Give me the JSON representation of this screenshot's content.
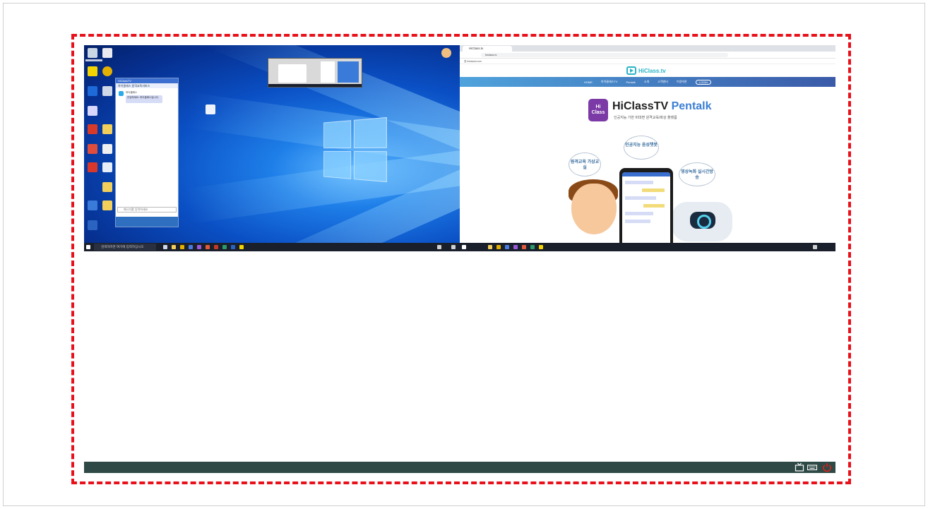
{
  "left_desktop": {
    "chat_window_title": "HiClassTV",
    "chat_subtitle": "하이클래스 원격교육서비스",
    "chat_sender": "하이클래스",
    "chat_message": "안녕하세요. 하이클래스입니다.",
    "chat_input_placeholder": "메시지를 입력하세요",
    "taskbar_search": "검색하려면 여기에 입력하십시오"
  },
  "browser": {
    "tab_title": "HiClass.tv",
    "url": "hiclass.tv",
    "bookmark_text": "앱  hiclasstv.com",
    "site_logo": "HiClass.tv",
    "nav_items": [
      "HOME",
      "하이클래스TV",
      "Pentalk",
      "소개",
      "고객센터",
      "이용약관"
    ],
    "nav_pill": "LOGIN",
    "brand_logo_line1": "Hi",
    "brand_logo_line2": "Class",
    "brand_title_main": "HiClassTV",
    "brand_title_accent": "Pentalk",
    "brand_subtitle": "인공지능 기반 비대면 원격교육/화상 플랫폼",
    "bubble_left": "원격교육 가상교실",
    "bubble_top": "인공지능 음성챗봇",
    "bubble_right": "영상녹화 실시간방송"
  },
  "bottom_bar": {
    "icons": [
      "tv-icon",
      "keyboard-icon",
      "power-icon"
    ]
  },
  "colors": {
    "dash_border": "#e8101a",
    "bottom_bar": "#2f4a46",
    "nav_gradient_start": "#4fa3dc",
    "nav_gradient_end": "#3a5aa8",
    "brand_accent": "#3b7ed4",
    "power_icon": "#e0201c"
  }
}
